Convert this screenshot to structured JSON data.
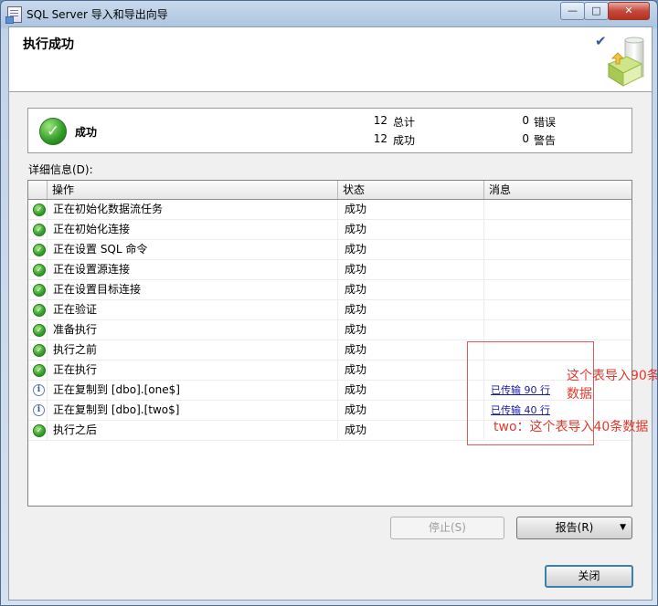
{
  "window": {
    "title": "SQL Server 导入和导出向导",
    "min": "—",
    "max": "□",
    "close": "✕"
  },
  "header": {
    "page_title": "执行成功",
    "check_mark": "✔"
  },
  "summary": {
    "status": "成功",
    "total_count": "12",
    "total_label": "总计",
    "success_count": "12",
    "success_label": "成功",
    "error_count": "0",
    "error_label": "错误",
    "warning_count": "0",
    "warning_label": "警告"
  },
  "details": {
    "label": "详细信息(D):",
    "columns": [
      "操作",
      "状态",
      "消息"
    ],
    "rows": [
      {
        "icon": "success-icon",
        "action": "正在初始化数据流任务",
        "status": "成功",
        "message": ""
      },
      {
        "icon": "success-icon",
        "action": "正在初始化连接",
        "status": "成功",
        "message": ""
      },
      {
        "icon": "success-icon",
        "action": "正在设置 SQL 命令",
        "status": "成功",
        "message": ""
      },
      {
        "icon": "success-icon",
        "action": "正在设置源连接",
        "status": "成功",
        "message": ""
      },
      {
        "icon": "success-icon",
        "action": "正在设置目标连接",
        "status": "成功",
        "message": ""
      },
      {
        "icon": "success-icon",
        "action": "正在验证",
        "status": "成功",
        "message": ""
      },
      {
        "icon": "success-icon",
        "action": "准备执行",
        "status": "成功",
        "message": ""
      },
      {
        "icon": "success-icon",
        "action": "执行之前",
        "status": "成功",
        "message": ""
      },
      {
        "icon": "success-icon",
        "action": "正在执行",
        "status": "成功",
        "message": ""
      },
      {
        "icon": "info-icon",
        "action": "正在复制到 [dbo].[one$]",
        "status": "成功",
        "message": "已传输 90 行"
      },
      {
        "icon": "info-icon",
        "action": "正在复制到 [dbo].[two$]",
        "status": "成功",
        "message": "已传输 40 行"
      },
      {
        "icon": "success-icon",
        "action": "执行之后",
        "status": "成功",
        "message": ""
      }
    ]
  },
  "annotations": {
    "note_one": "这个表导入90条数据",
    "note_two": "two：这个表导入40条数据"
  },
  "buttons": {
    "stop": "停止(S)",
    "report": "报告(R)",
    "report_arrow": "▼",
    "close": "关闭"
  },
  "colors": {
    "annotation": "#e3392c",
    "success": "#2f9a26",
    "link": "#1a1aa6"
  }
}
